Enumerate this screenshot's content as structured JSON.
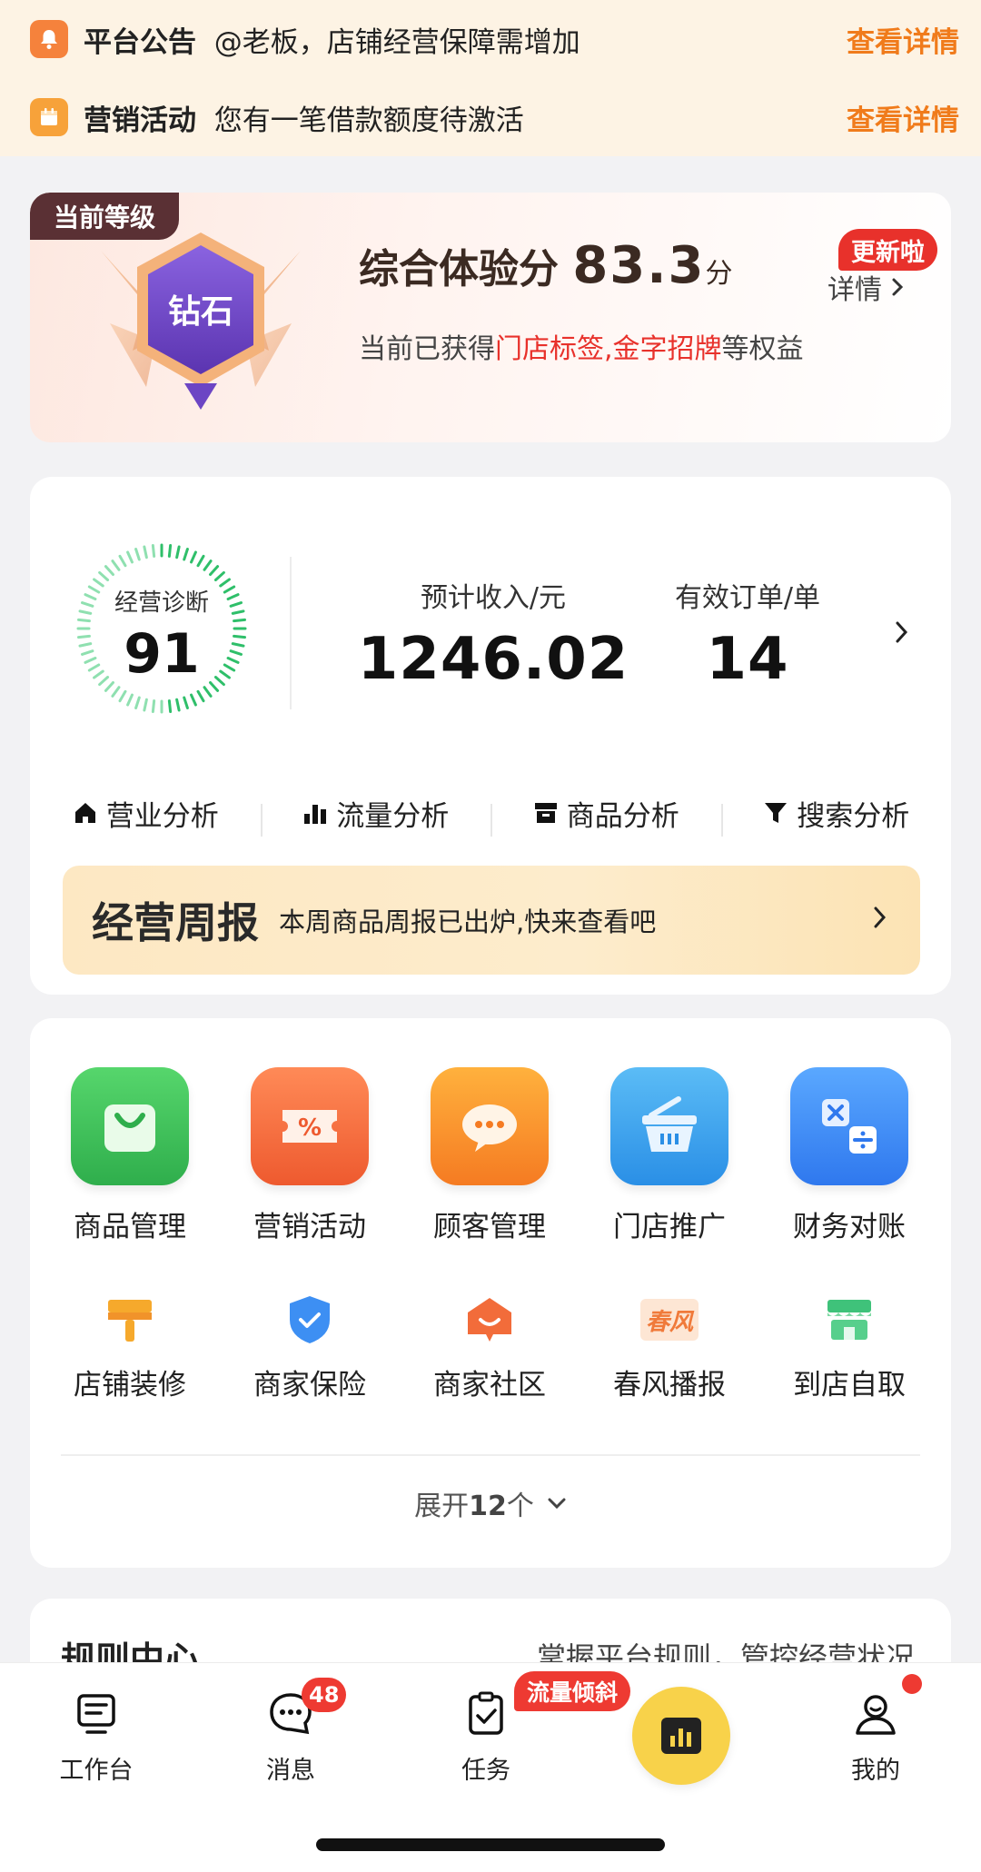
{
  "notices": [
    {
      "label": "平台公告",
      "text": "@老板，店铺经营保障需增加",
      "link": "查看详情",
      "icon": "bell-icon"
    },
    {
      "label": "营销活动",
      "text": "您有一笔借款额度待激活",
      "link": "查看详情",
      "icon": "calendar-icon"
    }
  ],
  "level": {
    "tag": "当前等级",
    "badge_text": "钻石",
    "score_label": "综合体验分",
    "score": "83.3",
    "score_unit": "分",
    "update_badge": "更新啦",
    "detail_link": "详情",
    "desc_prefix": "当前已获得",
    "desc_highlight": "门店标签,金字招牌",
    "desc_suffix": "等权益"
  },
  "stats": {
    "diagnosis_label": "经营诊断",
    "diagnosis_score": "91",
    "income_label": "预计收入/元",
    "income_value": "1246.02",
    "orders_label": "有效订单/单",
    "orders_value": "14"
  },
  "analysis": [
    {
      "label": "营业分析",
      "icon": "home-icon"
    },
    {
      "label": "流量分析",
      "icon": "bar-chart-icon"
    },
    {
      "label": "商品分析",
      "icon": "box-icon"
    },
    {
      "label": "搜索分析",
      "icon": "filter-icon"
    }
  ],
  "weekly": {
    "title": "经营周报",
    "text": "本周商品周报已出炉,快来查看吧"
  },
  "apps": [
    {
      "label": "商品管理",
      "icon": "shopping-bag-icon",
      "color": "#3ec25a"
    },
    {
      "label": "营销活动",
      "icon": "coupon-icon",
      "color": "#f26a3c"
    },
    {
      "label": "顾客管理",
      "icon": "chat-stars-icon",
      "color": "#f5912a"
    },
    {
      "label": "门店推广",
      "icon": "basket-icon",
      "color": "#3aa2f0"
    },
    {
      "label": "财务对账",
      "icon": "calculator-icon",
      "color": "#3b8cf2"
    }
  ],
  "small_apps": [
    {
      "label": "店铺装修",
      "icon": "paint-brush-icon"
    },
    {
      "label": "商家保险",
      "icon": "shield-icon"
    },
    {
      "label": "商家社区",
      "icon": "community-icon"
    },
    {
      "label": "春风播报",
      "icon": "spring-news-icon",
      "icon_text": "春风"
    },
    {
      "label": "到店自取",
      "icon": "storefront-icon"
    }
  ],
  "expand": {
    "prefix": "展开",
    "count": "12",
    "suffix": "个"
  },
  "rules": {
    "title": "规则中心",
    "subtitle": "掌握平台规则，管控经营状况"
  },
  "tabbar": {
    "workbench": "工作台",
    "messages": "消息",
    "messages_badge": "48",
    "tasks": "任务",
    "tasks_badge": "流量倾斜",
    "me": "我的"
  }
}
